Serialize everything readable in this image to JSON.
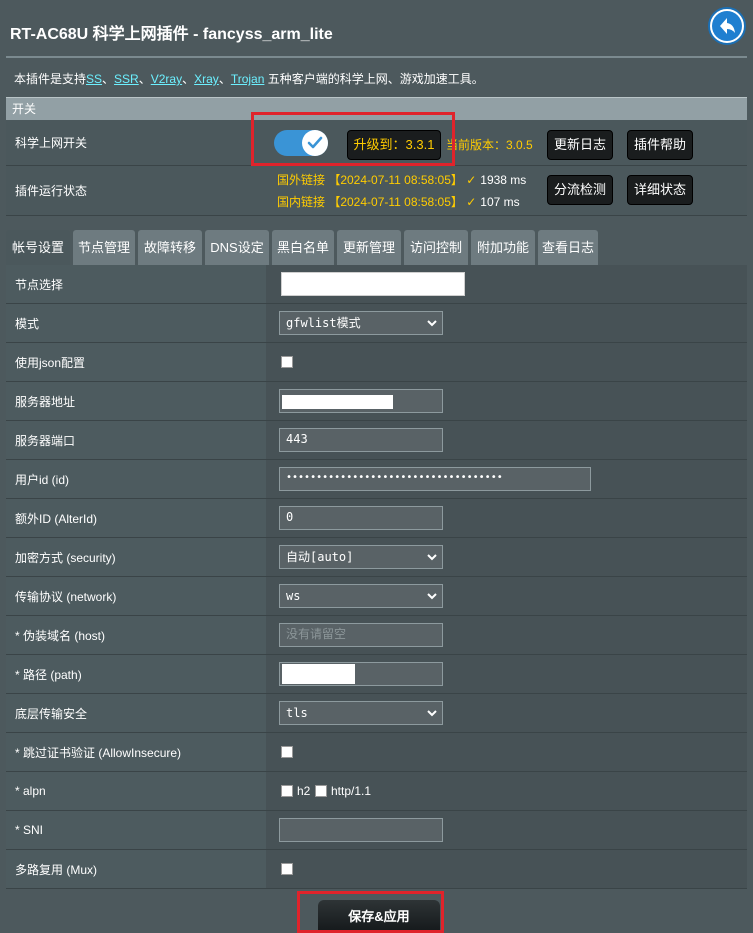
{
  "title": "RT-AC68U 科学上网插件 - fancyss_arm_lite",
  "description": {
    "prefix": "本插件是支持",
    "links": [
      "SS",
      "SSR",
      "V2ray",
      "Xray",
      "Trojan"
    ],
    "separator": "、",
    "suffix": "五种客户端的科学上网、游戏加速工具。"
  },
  "section_switch": "开关",
  "main_switch": {
    "label": "科学上网开关",
    "enabled": true,
    "upgrade_button": "升级到：3.3.1",
    "current_version": "当前版本：3.0.5",
    "changelog_button": "更新日志",
    "help_button": "插件帮助"
  },
  "run_status": {
    "label": "插件运行状态",
    "foreign": {
      "text": "国外链接 【2024-07-11 08:58:05】 ✓",
      "ms": "1938 ms"
    },
    "domestic": {
      "text": "国内链接 【2024-07-11 08:58:05】 ✓",
      "ms": "107 ms"
    },
    "split_button": "分流检测",
    "detail_button": "详细状态"
  },
  "tabs": [
    "帐号设置",
    "节点管理",
    "故障转移",
    "DNS设定",
    "黑白名单",
    "更新管理",
    "访问控制",
    "附加功能",
    "查看日志"
  ],
  "form": {
    "node_label": "节点选择",
    "mode_label": "模式",
    "mode_value": "gfwlist模式",
    "json_label": "使用json配置",
    "server_label": "服务器地址",
    "port_label": "服务器端口",
    "port_value": "443",
    "uid_label": "用户id (id)",
    "uid_value": "••••••••••••••••••••••••••••••••••••",
    "alterid_label": "额外ID (AlterId)",
    "alterid_value": "0",
    "security_label": "加密方式 (security)",
    "security_value": "自动[auto]",
    "network_label": "传输协议 (network)",
    "network_value": "ws",
    "host_label": "* 伪装域名 (host)",
    "host_placeholder": "没有请留空",
    "path_label": "* 路径 (path)",
    "tls_label": "底层传输安全",
    "tls_value": "tls",
    "insecure_label": "* 跳过证书验证 (AllowInsecure)",
    "alpn_label": "* alpn",
    "alpn_h2": "h2",
    "alpn_http": "http/1.1",
    "sni_label": "* SNI",
    "mux_label": "多路复用 (Mux)"
  },
  "save_button": "保存&应用",
  "colors": {
    "background": "#4d595d",
    "accent": "#3a94d6",
    "highlight": "#e0232b",
    "status": "#ffcc00",
    "link": "#6cf0ff"
  }
}
